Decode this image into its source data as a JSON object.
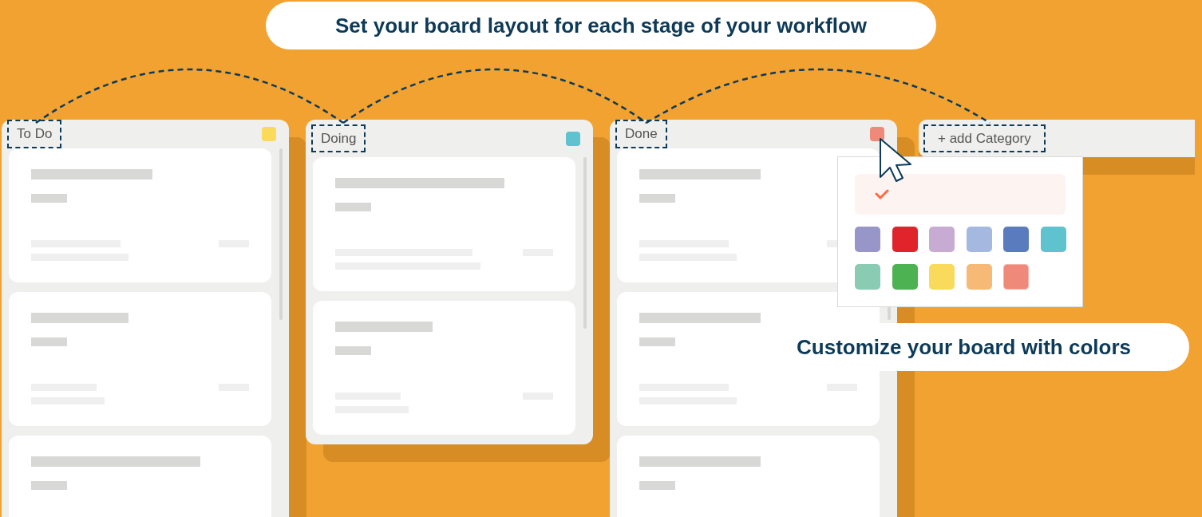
{
  "callouts": [
    {
      "kind": "top",
      "text": "Set your board layout for each stage of your workflow"
    },
    {
      "kind": "bottom",
      "text": "Customize your board with colors"
    }
  ],
  "columns": [
    {
      "title": "To Do",
      "color": "#f9da5a",
      "cards": [
        {
          "kind": "medium"
        },
        {
          "kind": "short"
        },
        {
          "kind": "long"
        }
      ]
    },
    {
      "title": "Doing",
      "color": "#5ec3cf",
      "cards": [
        {
          "kind": "long"
        },
        {
          "kind": "short"
        }
      ]
    },
    {
      "title": "Done",
      "color": "#ef8a7a",
      "cards": [
        {
          "kind": "medium"
        },
        {
          "kind": "medium"
        },
        {
          "kind": "medium"
        }
      ]
    }
  ],
  "add_category": {
    "label": "+ add Category"
  },
  "color_picker": {
    "swatches": [
      {
        "color": "#9896c8",
        "selected": false
      },
      {
        "color": "#e1242c",
        "selected": false
      },
      {
        "color": "#c7abd2",
        "selected": false
      },
      {
        "color": "#a5b9e0",
        "selected": false
      },
      {
        "color": "#5a7bbd",
        "selected": false
      },
      {
        "color": "#5ec3cf",
        "selected": false
      },
      {
        "color": "#8acbb4",
        "selected": false
      },
      {
        "color": "#4db251",
        "selected": false
      },
      {
        "color": "#f9da5a",
        "selected": false
      },
      {
        "color": "#f7b976",
        "selected": false
      },
      {
        "color": "#ef8a7a",
        "selected": true
      }
    ]
  }
}
